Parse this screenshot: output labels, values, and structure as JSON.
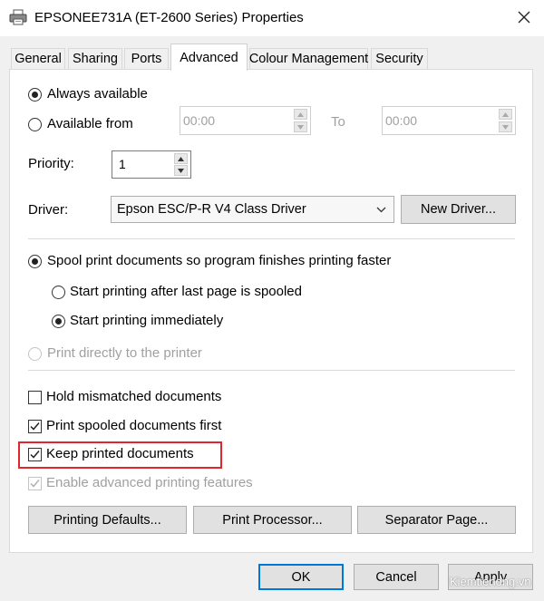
{
  "window": {
    "title": "EPSONEE731A (ET-2600 Series) Properties",
    "icon": "printer-icon",
    "close_icon": "close-icon"
  },
  "tabs": [
    {
      "label": "General",
      "active": false
    },
    {
      "label": "Sharing",
      "active": false
    },
    {
      "label": "Ports",
      "active": false
    },
    {
      "label": "Advanced",
      "active": true
    },
    {
      "label": "Colour Management",
      "active": false
    },
    {
      "label": "Security",
      "active": false
    }
  ],
  "availability": {
    "always_label": "Always available",
    "always_selected": true,
    "from_label": "Available from",
    "from_selected": false,
    "from_value": "00:00",
    "to_label": "To",
    "to_value": "00:00"
  },
  "priority": {
    "label": "Priority:",
    "value": "1"
  },
  "driver": {
    "label": "Driver:",
    "selected": "Epson ESC/P-R V4 Class Driver",
    "new_driver_button": "New Driver..."
  },
  "spool": {
    "spool_label": "Spool print documents so program finishes printing faster",
    "spool_selected": true,
    "after_last_label": "Start printing after last page is spooled",
    "after_last_selected": false,
    "immediately_label": "Start printing immediately",
    "immediately_selected": true,
    "direct_label": "Print directly to the printer",
    "direct_selected": false,
    "direct_enabled": false
  },
  "options": [
    {
      "label": "Hold mismatched documents",
      "checked": false,
      "enabled": true,
      "highlighted": false
    },
    {
      "label": "Print spooled documents first",
      "checked": true,
      "enabled": true,
      "highlighted": false
    },
    {
      "label": "Keep printed documents",
      "checked": true,
      "enabled": true,
      "highlighted": true
    },
    {
      "label": "Enable advanced printing features",
      "checked": true,
      "enabled": false,
      "highlighted": false
    }
  ],
  "bottom_buttons": {
    "printing_defaults": "Printing Defaults...",
    "print_processor": "Print Processor...",
    "separator_page": "Separator Page..."
  },
  "dialog_buttons": {
    "ok": "OK",
    "cancel": "Cancel",
    "apply": "Apply"
  },
  "watermark": "Kiemtienong.vn",
  "colors": {
    "highlight": "#e0262e",
    "default_button_border": "#0078d7"
  }
}
